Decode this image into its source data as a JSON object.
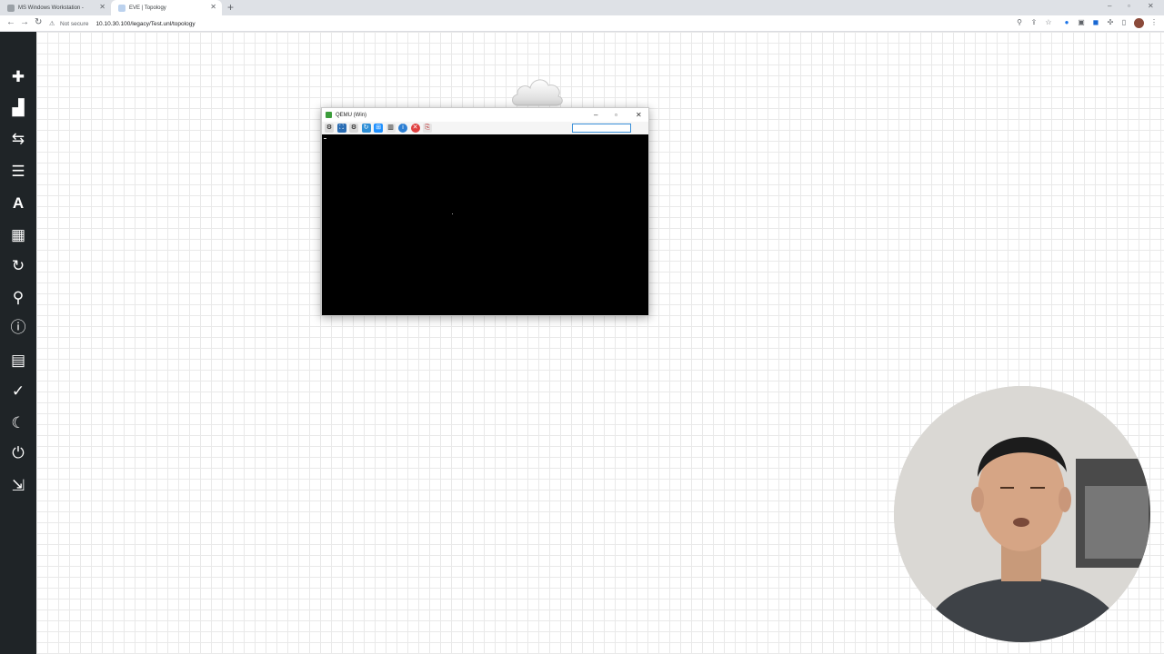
{
  "browser": {
    "tabs": [
      {
        "label": "MS Windows Workstation - ",
        "active": false
      },
      {
        "label": "EVE | Topology",
        "active": true
      }
    ],
    "security_label": "Not secure",
    "url": "10.10.30.100/legacy/Test.unl/topology"
  },
  "sidebar": {
    "items": [
      {
        "name": "add-icon",
        "glyph": "✚"
      },
      {
        "name": "node-icon",
        "glyph": "▟"
      },
      {
        "name": "networks-icon",
        "glyph": "⇆"
      },
      {
        "name": "list-icon",
        "glyph": "☰"
      },
      {
        "name": "text-icon",
        "glyph": "A"
      },
      {
        "name": "grid-icon",
        "glyph": "▦"
      },
      {
        "name": "refresh-icon",
        "glyph": "↻"
      },
      {
        "name": "zoom-icon",
        "glyph": "⚲"
      },
      {
        "name": "info-icon",
        "glyph": "ℹ"
      },
      {
        "name": "table-icon",
        "glyph": "▤"
      },
      {
        "name": "check-icon",
        "glyph": "✓"
      },
      {
        "name": "moon-icon",
        "glyph": "☾"
      },
      {
        "name": "power-icon",
        "glyph": "⏻"
      },
      {
        "name": "logout-icon",
        "glyph": "⇲"
      }
    ]
  },
  "qemu": {
    "title": "QEMU (Win)"
  }
}
